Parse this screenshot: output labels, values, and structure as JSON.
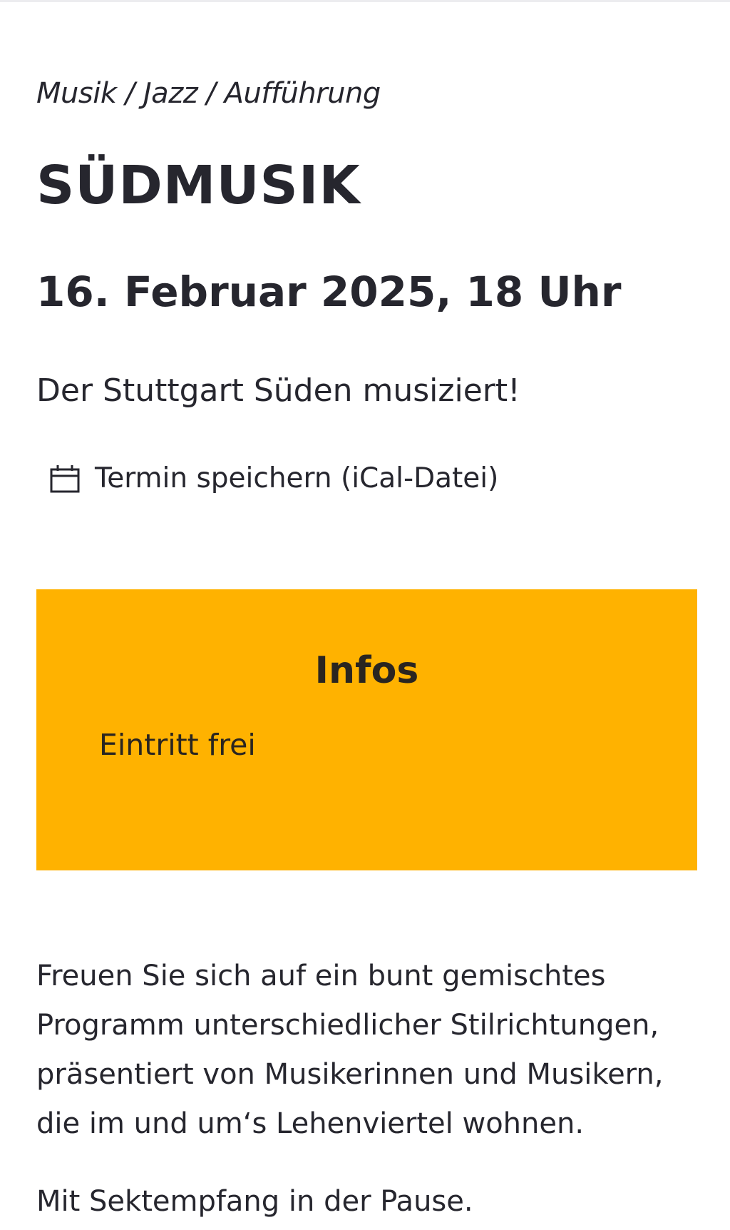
{
  "event": {
    "category": "Musik / Jazz / Aufführung",
    "title": "SÜDMUSIK",
    "date": "16. Februar 2025, 18 Uhr",
    "subtitle": "Der Stuttgart Süden musiziert!"
  },
  "ical": {
    "label": "Termin speichern (iCal-Datei)",
    "icon": "calendar-icon"
  },
  "info": {
    "heading": "Infos",
    "text": "Eintritt frei",
    "color": "#ffb200"
  },
  "description": {
    "paragraph1": "Freuen Sie sich auf ein bunt gemischtes Programm unterschiedlicher Stilrichtungen, präsentiert von Musikerinnen und Musikern, die im und um‘s Lehenviertel wohnen.",
    "paragraph2": "Mit Sektempfang in der Pause."
  }
}
